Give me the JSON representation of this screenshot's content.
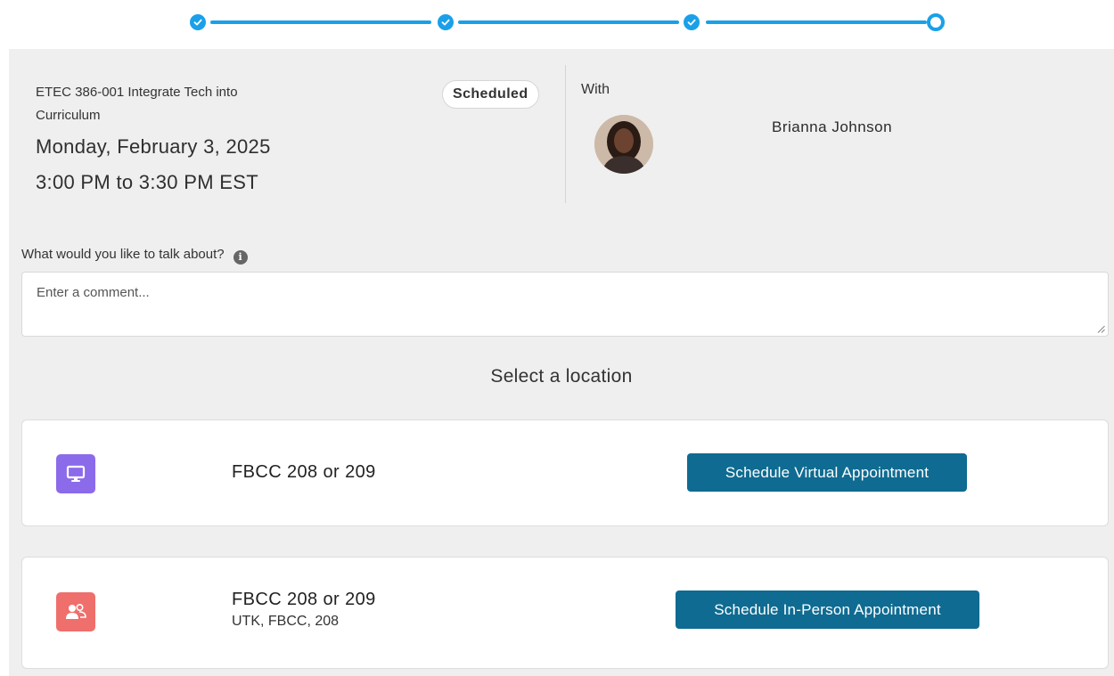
{
  "stepper": {
    "steps": [
      {
        "state": "complete",
        "icon": "check-icon"
      },
      {
        "state": "complete",
        "icon": "check-icon"
      },
      {
        "state": "complete",
        "icon": "check-icon"
      },
      {
        "state": "current",
        "icon": "circle-icon"
      }
    ],
    "accent_color": "#1aa0e8"
  },
  "appointment": {
    "course": "ETEC 386-001 Integrate Tech into Curriculum",
    "status": "Scheduled",
    "date": "Monday, February 3, 2025",
    "time": "3:00 PM to 3:30 PM EST",
    "with_label": "With",
    "advisor_name": "Brianna Johnson"
  },
  "comment": {
    "label": "What would you like to talk about?",
    "placeholder": "Enter a comment...",
    "value": ""
  },
  "locations": {
    "heading": "Select a location",
    "options": [
      {
        "icon": "monitor-icon",
        "icon_color": "#8b6bea",
        "name": "FBCC 208 or 209",
        "detail": "",
        "button_label": "Schedule Virtual Appointment"
      },
      {
        "icon": "people-icon",
        "icon_color": "#ef6f6c",
        "name": "FBCC 208 or 209",
        "detail": "UTK, FBCC, 208",
        "button_label": "Schedule In-Person Appointment"
      }
    ]
  },
  "colors": {
    "button": "#0f6b91",
    "panel_background": "#efefef"
  }
}
